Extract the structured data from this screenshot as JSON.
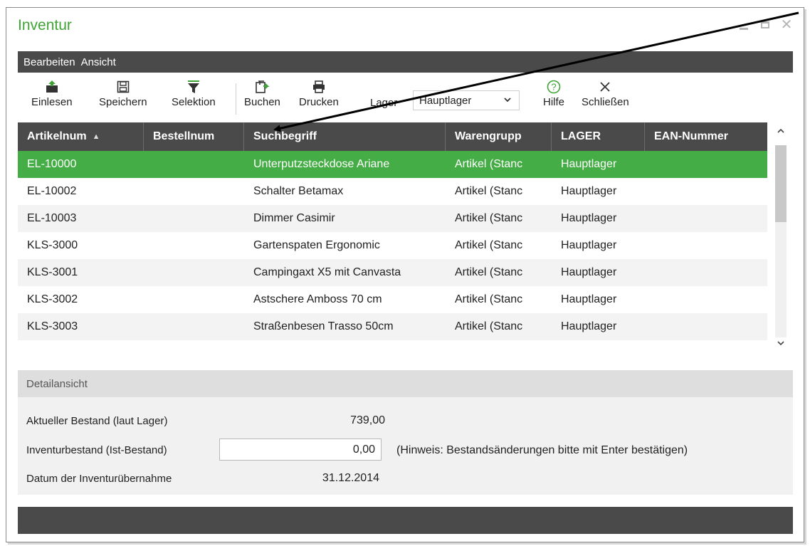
{
  "window": {
    "title": "Inventur",
    "controls": {
      "minimize_icon": "minimize-icon",
      "maximize_icon": "maximize-icon",
      "close_icon": "close-icon"
    }
  },
  "menu": {
    "items": [
      "Bearbeiten",
      "Ansicht"
    ]
  },
  "toolbar": {
    "buttons": [
      {
        "label": "Einlesen",
        "icon": "import-icon"
      },
      {
        "label": "Speichern",
        "icon": "save-icon"
      },
      {
        "label": "Selektion",
        "icon": "filter-icon"
      },
      {
        "label": "Buchen",
        "icon": "book-icon"
      },
      {
        "label": "Drucken",
        "icon": "print-icon"
      }
    ],
    "lager_label": "Lager",
    "lager_value": "Hauptlager",
    "help_label": "Hilfe",
    "close_label": "Schließen"
  },
  "grid": {
    "columns": [
      "Artikelnum",
      "Bestellnum",
      "Suchbegriff",
      "Warengrupp",
      "LAGER",
      "EAN-Nummer"
    ],
    "sort_indicator": "▲",
    "rows": [
      [
        "EL-10000",
        "",
        "Unterputzsteckdose Ariane",
        "Artikel (Stanc",
        "Hauptlager",
        ""
      ],
      [
        "EL-10002",
        "",
        "Schalter Betamax",
        "Artikel (Stanc",
        "Hauptlager",
        ""
      ],
      [
        "EL-10003",
        "",
        "Dimmer Casimir",
        "Artikel (Stanc",
        "Hauptlager",
        ""
      ],
      [
        "KLS-3000",
        "",
        "Gartenspaten Ergonomic",
        "Artikel (Stanc",
        "Hauptlager",
        ""
      ],
      [
        "KLS-3001",
        "",
        "Campingaxt X5 mit Canvasta",
        "Artikel (Stanc",
        "Hauptlager",
        ""
      ],
      [
        "KLS-3002",
        "",
        "Astschere Amboss 70 cm",
        "Artikel (Stanc",
        "Hauptlager",
        ""
      ],
      [
        "KLS-3003",
        "",
        "Straßenbesen Trasso 50cm",
        "Artikel (Stanc",
        "Hauptlager",
        ""
      ]
    ],
    "selected_row": 0
  },
  "detail": {
    "header": "Detailansicht",
    "bestand_label": "Aktueller Bestand (laut Lager)",
    "bestand_value": "739,00",
    "inventur_label": "Inventurbestand (Ist-Bestand)",
    "inventur_value": "0,00",
    "hint": "(Hinweis: Bestandsänderungen bitte mit Enter bestätigen)",
    "datum_label": "Datum der Inventurübernahme",
    "datum_value": "31.12.2014"
  },
  "colors": {
    "accent_green": "#3fa435",
    "selected_row": "#45ad45",
    "dark_bar": "#4a4a4a"
  }
}
